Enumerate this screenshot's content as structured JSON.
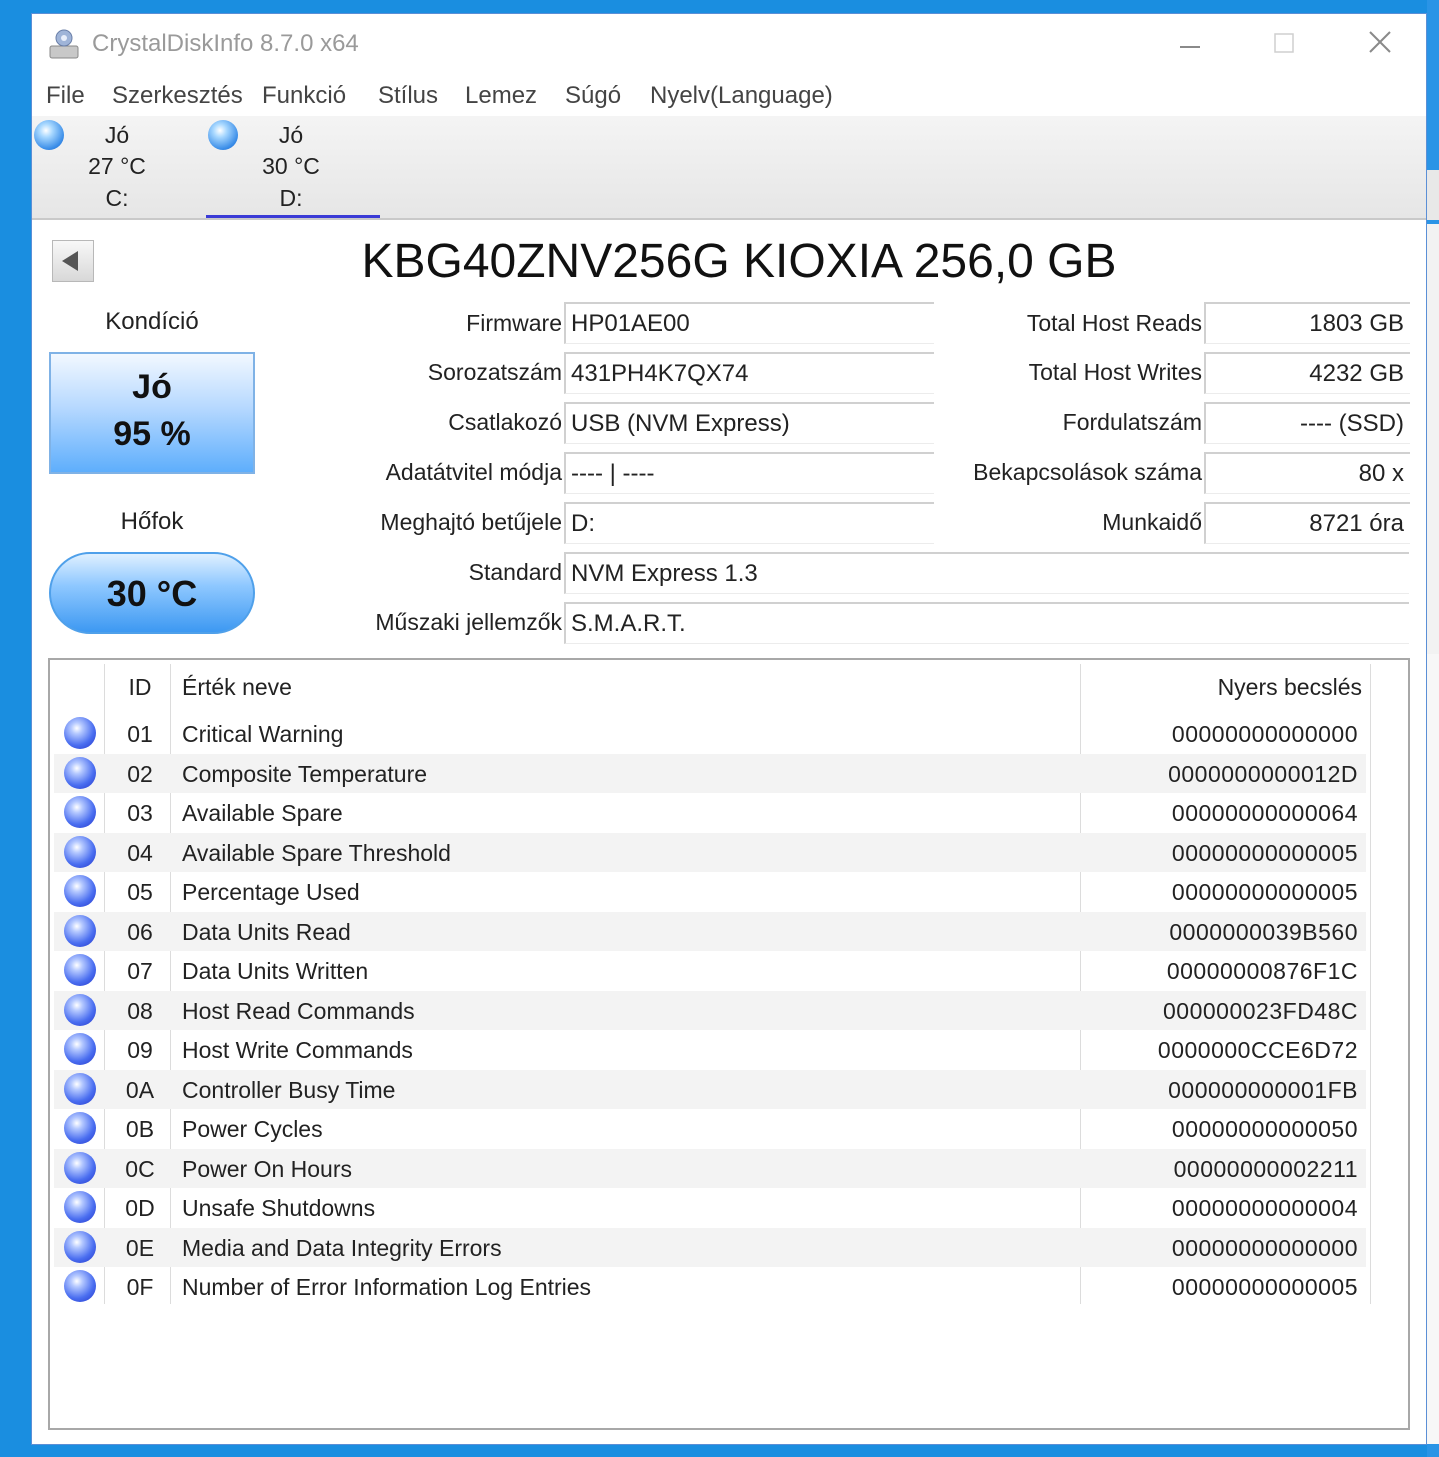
{
  "window": {
    "title": "CrystalDiskInfo 8.7.0 x64"
  },
  "menu": [
    "File",
    "Szerkesztés",
    "Funkció",
    "Stílus",
    "Lemez",
    "Súgó",
    "Nyelv(Language)"
  ],
  "drives": [
    {
      "status": "Jó",
      "temp": "27 °C",
      "letter": "C:"
    },
    {
      "status": "Jó",
      "temp": "30 °C",
      "letter": "D:"
    }
  ],
  "disk": {
    "title": "KBG40ZNV256G KIOXIA 256,0 GB"
  },
  "health": {
    "label": "Kondíció",
    "status": "Jó",
    "percent": "95 %"
  },
  "temperature": {
    "label": "Hőfok",
    "value": "30 °C"
  },
  "fields_left": [
    {
      "label": "Firmware",
      "value": "HP01AE00"
    },
    {
      "label": "Sorozatszám",
      "value": "431PH4K7QX74"
    },
    {
      "label": "Csatlakozó",
      "value": "USB (NVM Express)"
    },
    {
      "label": "Adatátvitel módja",
      "value": "---- | ----"
    },
    {
      "label": "Meghajtó betűjele",
      "value": "D:"
    },
    {
      "label": "Standard",
      "value": "NVM Express 1.3"
    },
    {
      "label": "Műszaki jellemzők",
      "value": "S.M.A.R.T."
    }
  ],
  "fields_right": [
    {
      "label": "Total Host Reads",
      "value": "1803 GB"
    },
    {
      "label": "Total Host Writes",
      "value": "4232 GB"
    },
    {
      "label": "Fordulatszám",
      "value": "---- (SSD)"
    },
    {
      "label": "Bekapcsolások száma",
      "value": "80 x"
    },
    {
      "label": "Munkaidő",
      "value": "8721 óra"
    }
  ],
  "smart": {
    "headers": {
      "id": "ID",
      "name": "Érték neve",
      "raw": "Nyers becslés"
    },
    "rows": [
      {
        "id": "01",
        "name": "Critical Warning",
        "raw": "00000000000000"
      },
      {
        "id": "02",
        "name": "Composite Temperature",
        "raw": "0000000000012D"
      },
      {
        "id": "03",
        "name": "Available Spare",
        "raw": "00000000000064"
      },
      {
        "id": "04",
        "name": "Available Spare Threshold",
        "raw": "00000000000005"
      },
      {
        "id": "05",
        "name": "Percentage Used",
        "raw": "00000000000005"
      },
      {
        "id": "06",
        "name": "Data Units Read",
        "raw": "0000000039B560"
      },
      {
        "id": "07",
        "name": "Data Units Written",
        "raw": "00000000876F1C"
      },
      {
        "id": "08",
        "name": "Host Read Commands",
        "raw": "000000023FD48C"
      },
      {
        "id": "09",
        "name": "Host Write Commands",
        "raw": "0000000CCE6D72"
      },
      {
        "id": "0A",
        "name": "Controller Busy Time",
        "raw": "000000000001FB"
      },
      {
        "id": "0B",
        "name": "Power Cycles",
        "raw": "00000000000050"
      },
      {
        "id": "0C",
        "name": "Power On Hours",
        "raw": "00000000002211"
      },
      {
        "id": "0D",
        "name": "Unsafe Shutdowns",
        "raw": "00000000000004"
      },
      {
        "id": "0E",
        "name": "Media and Data Integrity Errors",
        "raw": "00000000000000"
      },
      {
        "id": "0F",
        "name": "Number of Error Information Log Entries",
        "raw": "00000000000005"
      }
    ]
  }
}
